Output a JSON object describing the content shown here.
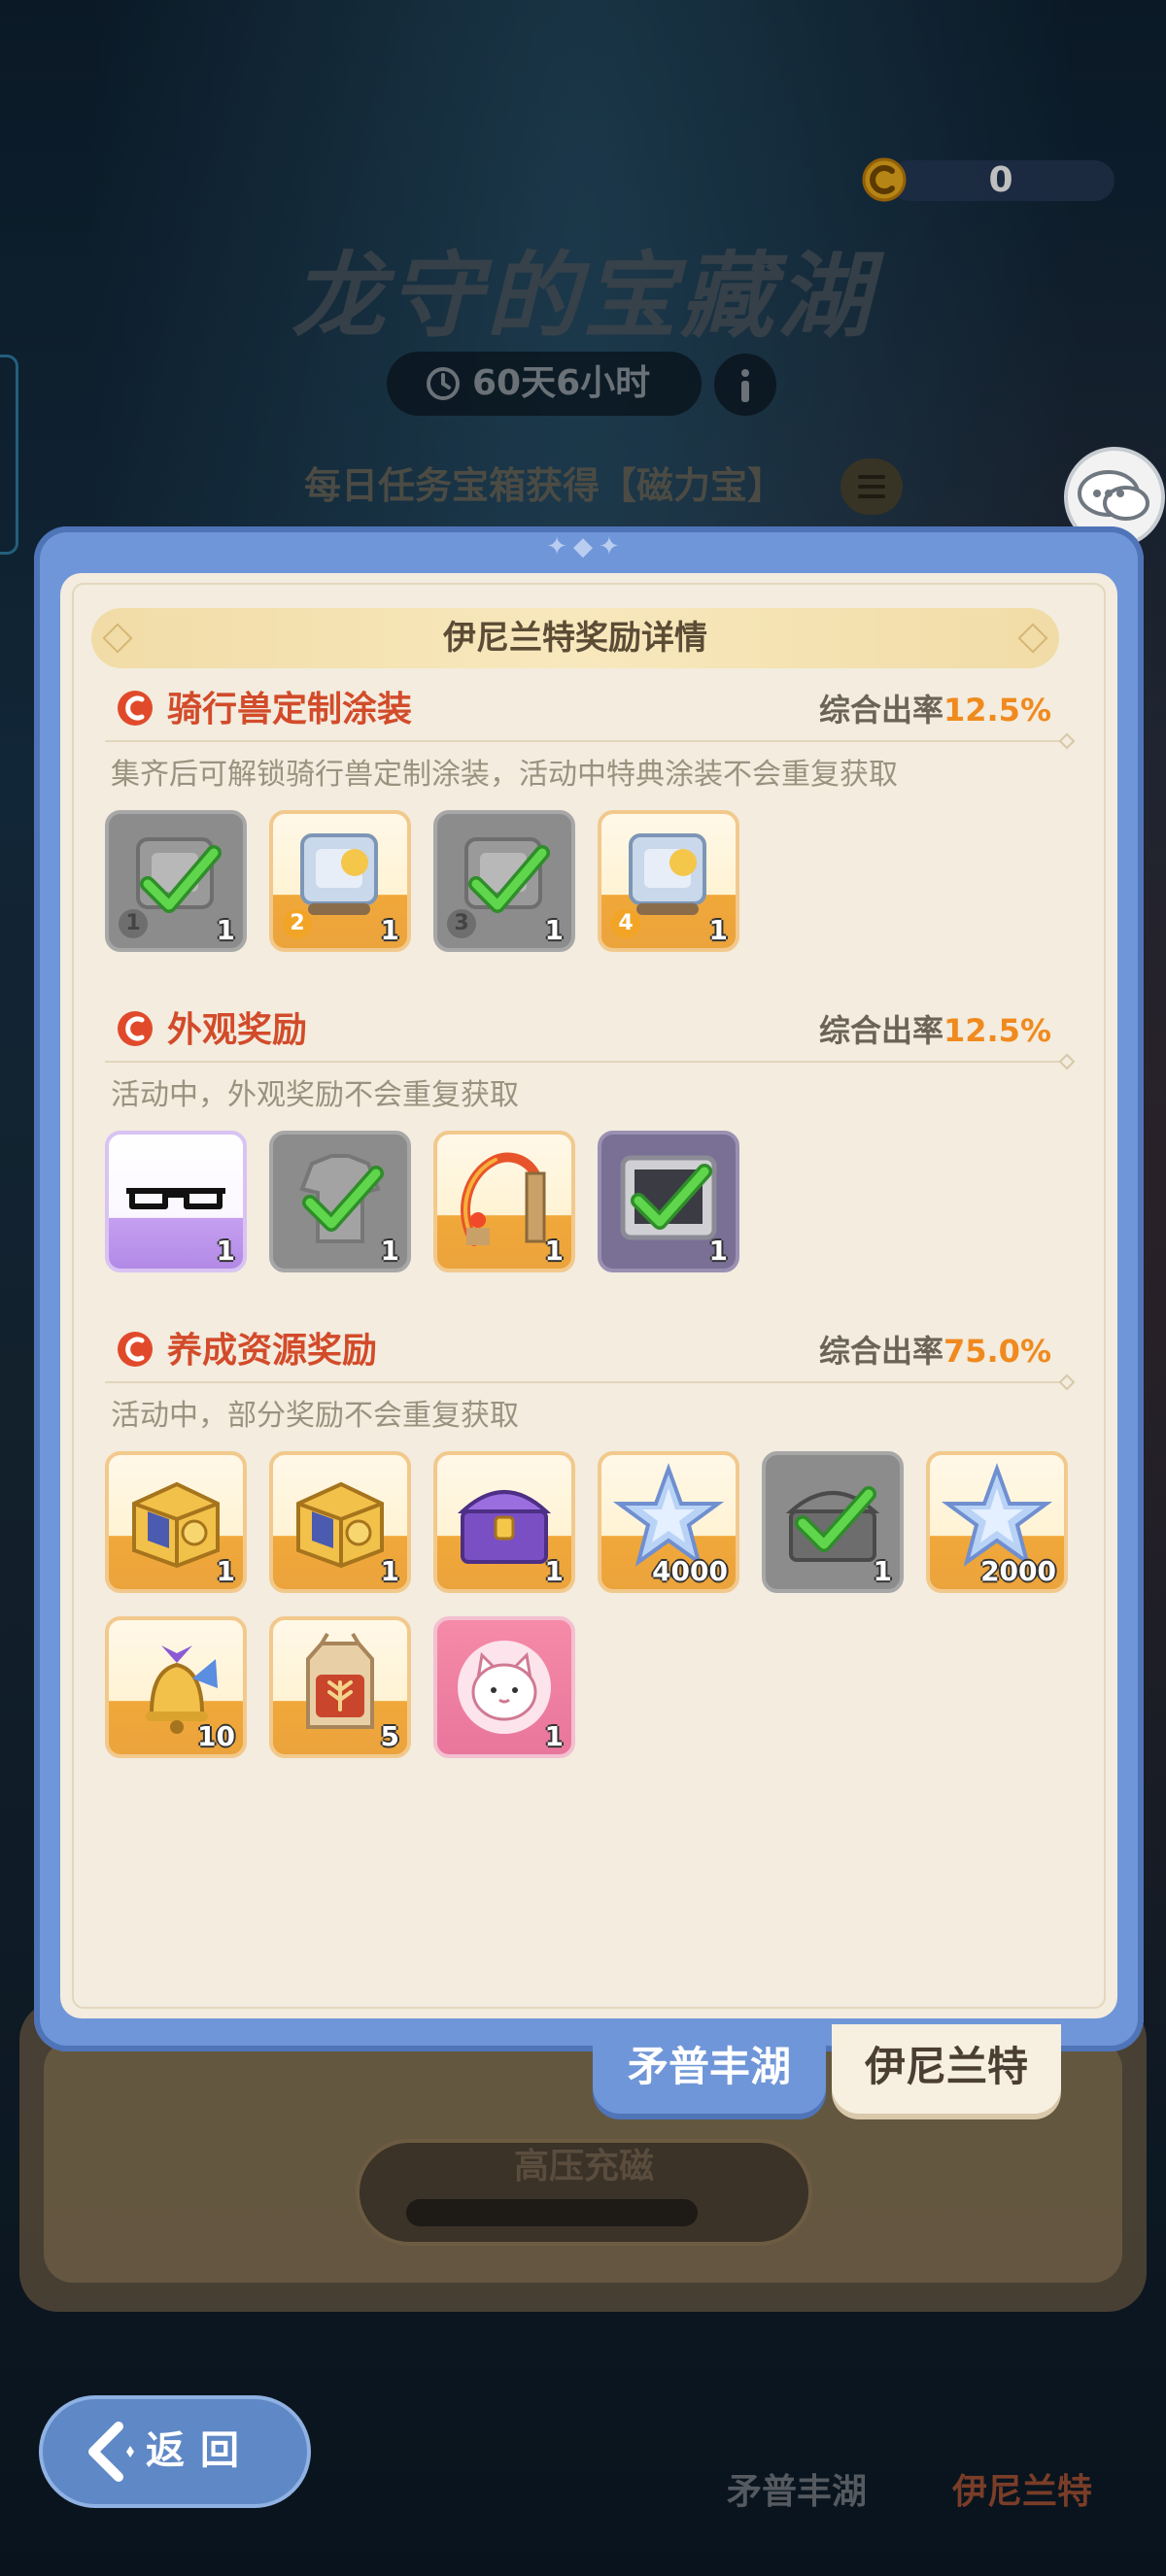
{
  "header": {
    "currency_value": "0",
    "title": "龙守的宝藏湖",
    "timer": "60天6小时",
    "daily_text": "每日任务宝箱获得【磁力宝】"
  },
  "dialog": {
    "banner_title": "伊尼兰特奖励详情",
    "sections": [
      {
        "title": "骑行兽定制涂装",
        "rate_label": "综合出率",
        "rate_value": "12.5%",
        "desc": "集齐后可解锁骑行兽定制涂装，活动中特典涂装不会重复获取",
        "items": [
          {
            "icon": "mount-skin-box-icon",
            "count": "1",
            "tag": "1",
            "obtained": true
          },
          {
            "icon": "mount-skin-box-icon",
            "count": "1",
            "tag": "2",
            "obtained": false
          },
          {
            "icon": "mount-skin-box-icon",
            "count": "1",
            "tag": "3",
            "obtained": true
          },
          {
            "icon": "mount-skin-box-icon",
            "count": "1",
            "tag": "4",
            "obtained": false
          }
        ]
      },
      {
        "title": "外观奖励",
        "rate_label": "综合出率",
        "rate_value": "12.5%",
        "desc": "活动中，外观奖励不会重复获取",
        "items": [
          {
            "icon": "eyewear-icon",
            "count": "1",
            "obtained": false
          },
          {
            "icon": "outfit-icon",
            "count": "1",
            "obtained": true
          },
          {
            "icon": "flame-frame-icon",
            "count": "1",
            "obtained": false
          },
          {
            "icon": "photo-frame-icon",
            "count": "1",
            "obtained": true
          }
        ]
      },
      {
        "title": "养成资源奖励",
        "rate_label": "综合出率",
        "rate_value": "75.0%",
        "desc": "活动中，部分奖励不会重复获取",
        "items": [
          {
            "icon": "gold-chest-icon",
            "count": "1",
            "obtained": false
          },
          {
            "icon": "gold-chest-icon",
            "count": "1",
            "obtained": false
          },
          {
            "icon": "purple-chest-icon",
            "count": "1",
            "obtained": false
          },
          {
            "icon": "star-crystal-icon",
            "count": "4000",
            "obtained": false
          },
          {
            "icon": "dark-chest-icon",
            "count": "1",
            "obtained": true
          },
          {
            "icon": "star-crystal-icon",
            "count": "2000",
            "obtained": false
          },
          {
            "icon": "golden-bell-icon",
            "count": "10",
            "obtained": false
          },
          {
            "icon": "seed-bag-icon",
            "count": "5",
            "obtained": false
          },
          {
            "icon": "cat-avatar-icon",
            "count": "1",
            "obtained": false
          }
        ]
      }
    ],
    "tabs": [
      "矛普丰湖",
      "伊尼兰特"
    ],
    "active_tab": "伊尼兰特"
  },
  "lower": {
    "charge_label": "高压充磁",
    "back_label": "返回",
    "lake_tabs": [
      "矛普丰湖",
      "伊尼兰特"
    ]
  },
  "colors": {
    "accent_red": "#d24b2a",
    "rate_orange": "#f08a1e",
    "dialog_blue": "#6f96d8",
    "paper": "#f3ecdf"
  }
}
